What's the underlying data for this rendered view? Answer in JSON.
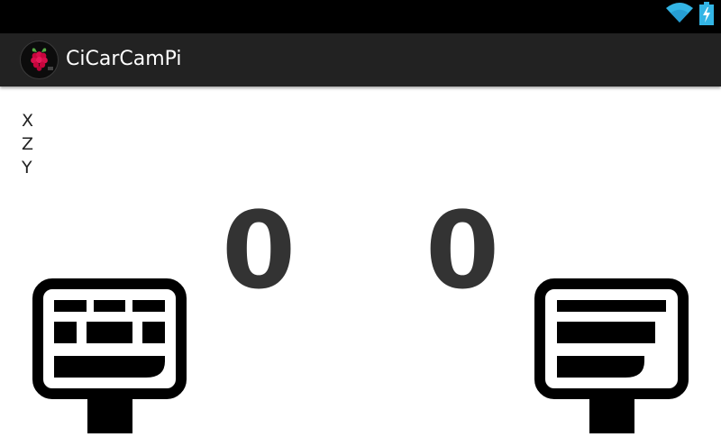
{
  "status_bar": {
    "icons": [
      "wifi-icon",
      "battery-charging-icon"
    ]
  },
  "action_bar": {
    "title": "CiCarCamPi",
    "app_icon": "raspberry-pi-icon"
  },
  "axes": {
    "x_label": "X",
    "z_label": "Z",
    "y_label": "Y"
  },
  "readouts": {
    "left_value": "0",
    "right_value": "0"
  },
  "controls": {
    "left_icon": "keyboard-stand-icon",
    "right_icon": "text-stand-icon"
  }
}
